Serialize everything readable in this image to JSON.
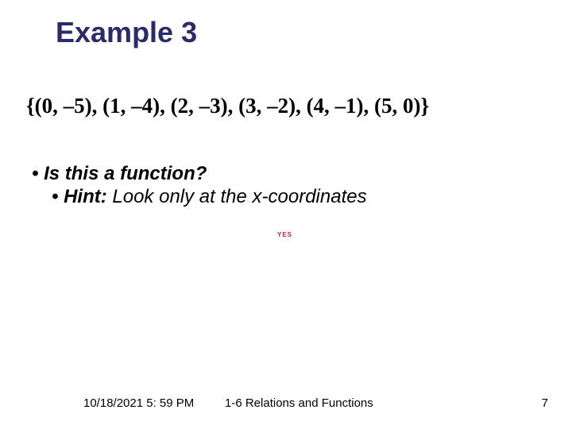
{
  "title": "Example 3",
  "set_expr": "{(0, –5), (1, –4), (2, –3), (3, –2), (4, –1), (5, 0)}",
  "q1": "• Is this a function?",
  "q2_lead": "• Hint:",
  "q2_rest": "  Look only at the x-coordinates",
  "yes": "YES",
  "footer": {
    "date": "10/18/2021 5: 59 PM",
    "mid": "1-6 Relations and Functions",
    "page": "7"
  }
}
